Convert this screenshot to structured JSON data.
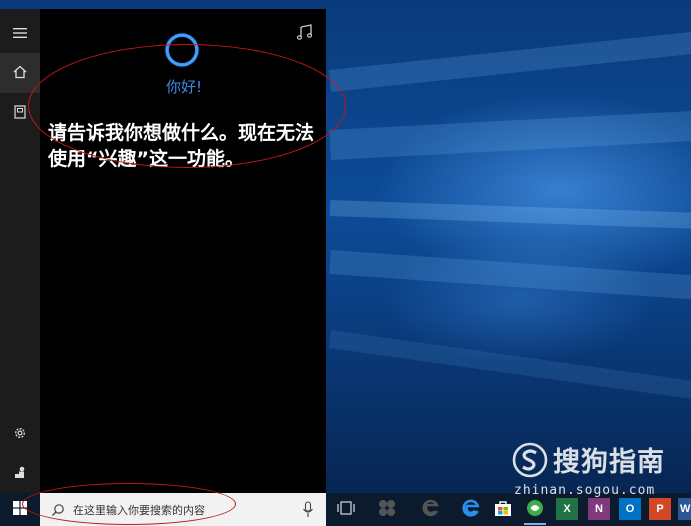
{
  "cortana": {
    "greeting": "你好!",
    "message": "请告诉我你想做什么。现在无法使用“兴趣”这一功能。"
  },
  "rail": {
    "items": [
      {
        "icon": "hamburger-menu-icon"
      },
      {
        "icon": "home-icon",
        "selected": true
      },
      {
        "icon": "notebook-icon"
      },
      {
        "icon": "gear-icon"
      },
      {
        "icon": "feedback-icon"
      }
    ]
  },
  "taskbar": {
    "search_placeholder": "在这里输入你要搜索的内容",
    "apps": [
      {
        "icon": "task-view-icon"
      },
      {
        "icon": "people-icon"
      },
      {
        "icon": "edge-legacy-icon"
      },
      {
        "icon": "edge-icon"
      },
      {
        "icon": "store-icon"
      },
      {
        "icon": "sogou-browser-icon"
      },
      {
        "icon": "excel-icon",
        "label": "X"
      },
      {
        "icon": "onenote-icon",
        "label": "N"
      },
      {
        "icon": "outlook-icon",
        "label": "O"
      },
      {
        "icon": "powerpoint-icon",
        "label": "P"
      },
      {
        "icon": "word-icon",
        "label": "W"
      }
    ]
  },
  "watermark": {
    "brand": "搜狗指南",
    "url": "zhinan.sogou.com"
  },
  "colors": {
    "accent": "#3a8de6",
    "annotation": "#c01818",
    "panel_bg": "#000000",
    "rail_bg": "#1c1c1c"
  }
}
